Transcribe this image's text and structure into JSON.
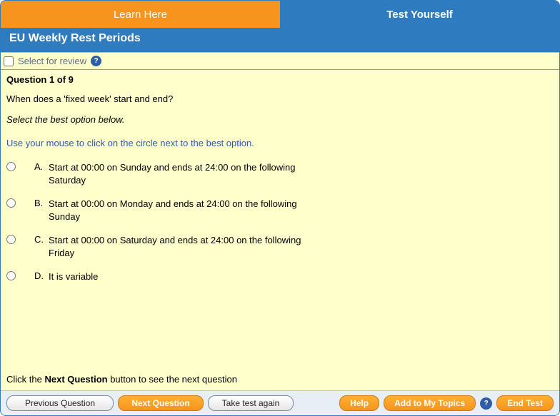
{
  "tabs": {
    "learn": "Learn Here",
    "test": "Test Yourself"
  },
  "topic_title": "EU Weekly Rest Periods",
  "review": {
    "label": "Select for review"
  },
  "question": {
    "counter": "Question 1 of 9",
    "text": "When does a 'fixed week' start and end?",
    "instruction": "Select the best option below.",
    "hint": "Use your mouse to click on the circle next to the best option.",
    "options": [
      {
        "letter": "A.",
        "text": "Start at 00:00 on Sunday and ends at 24:00 on the following Saturday"
      },
      {
        "letter": "B.",
        "text": "Start at 00:00 on Monday and ends at 24:00 on the following Sunday"
      },
      {
        "letter": "C.",
        "text": "Start at 00:00 on Saturday and ends at 24:00 on the following Friday"
      },
      {
        "letter": "D.",
        "text": "It is variable"
      }
    ]
  },
  "next_hint_prefix": "Click the ",
  "next_hint_bold": "Next Question",
  "next_hint_suffix": " button to see the next question",
  "footer": {
    "previous": "Previous Question",
    "next": "Next Question",
    "retake": "Take test again",
    "help": "Help",
    "add_topics": "Add to My Topics",
    "end_test": "End Test"
  }
}
